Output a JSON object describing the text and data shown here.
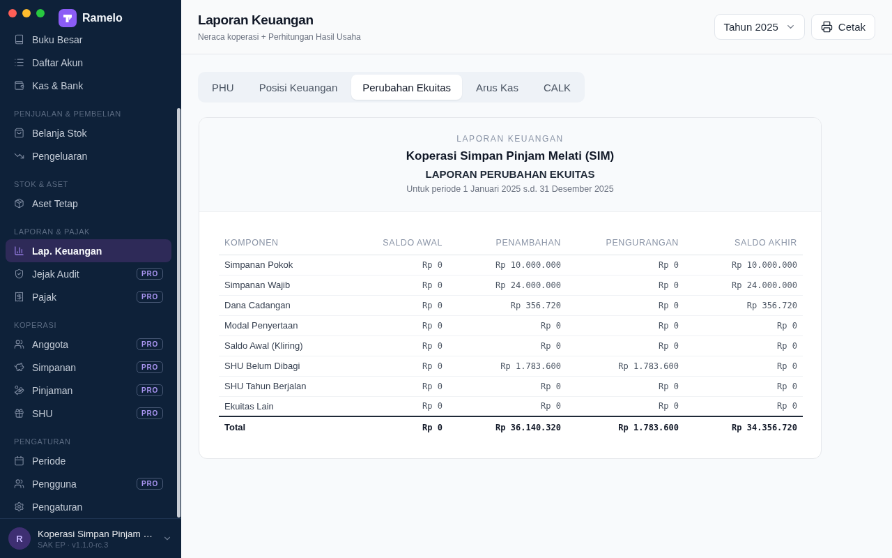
{
  "sidebar": {
    "app_name": "Ramelo",
    "sections": [
      {
        "items": [
          {
            "label": "Buku Besar",
            "selected": false
          },
          {
            "label": "Daftar Akun",
            "selected": false
          },
          {
            "label": "Kas & Bank",
            "selected": false
          }
        ]
      },
      {
        "heading": "PENJUALAN & PEMBELIAN",
        "items": [
          {
            "label": "Belanja Stok",
            "selected": false
          },
          {
            "label": "Pengeluaran",
            "selected": false
          }
        ]
      },
      {
        "heading": "STOK & ASET",
        "items": [
          {
            "label": "Aset Tetap",
            "selected": false
          }
        ]
      },
      {
        "heading": "LAPORAN & PAJAK",
        "items": [
          {
            "label": "Lap. Keuangan",
            "selected": true
          },
          {
            "label": "Jejak Audit",
            "selected": false,
            "badge": "PRO"
          },
          {
            "label": "Pajak",
            "selected": false,
            "badge": "PRO"
          }
        ]
      },
      {
        "heading": "KOPERASI",
        "items": [
          {
            "label": "Anggota",
            "selected": false,
            "badge": "PRO"
          },
          {
            "label": "Simpanan",
            "selected": false,
            "badge": "PRO"
          },
          {
            "label": "Pinjaman",
            "selected": false,
            "badge": "PRO"
          },
          {
            "label": "SHU",
            "selected": false,
            "badge": "PRO"
          }
        ]
      },
      {
        "heading": "PENGATURAN",
        "items": [
          {
            "label": "Periode",
            "selected": false
          },
          {
            "label": "Pengguna",
            "selected": false,
            "badge": "PRO"
          },
          {
            "label": "Pengaturan",
            "selected": false
          }
        ]
      }
    ],
    "account": {
      "initial": "R",
      "name": "Koperasi Simpan Pinjam …",
      "subtitle": "SAK EP · v1.1.0-rc.3"
    }
  },
  "header": {
    "title": "Laporan Keuangan",
    "subtitle": "Neraca koperasi + Perhitungan Hasil Usaha",
    "year_select": {
      "value": "Tahun 2025"
    },
    "print_button": {
      "label": "Cetak"
    }
  },
  "tabs": [
    {
      "label": "PHU",
      "selected": false
    },
    {
      "label": "Posisi Keuangan",
      "selected": false
    },
    {
      "label": "Perubahan Ekuitas",
      "selected": true
    },
    {
      "label": "Arus Kas",
      "selected": false
    },
    {
      "label": "CALK",
      "selected": false
    }
  ],
  "report": {
    "eyebrow": "LAPORAN KEUANGAN",
    "organization": "Koperasi Simpan Pinjam Melati (SIM)",
    "title": "LAPORAN PERUBAHAN EKUITAS",
    "period": "Untuk periode 1 Januari 2025 s.d. 31 Desember 2025",
    "table": {
      "columns": [
        "KOMPONEN",
        "SALDO AWAL",
        "PENAMBAHAN",
        "PENGURANGAN",
        "SALDO AKHIR"
      ],
      "rows": [
        [
          "Simpanan Pokok",
          "Rp 0",
          "Rp 10.000.000",
          "Rp 0",
          "Rp 10.000.000"
        ],
        [
          "Simpanan Wajib",
          "Rp 0",
          "Rp 24.000.000",
          "Rp 0",
          "Rp 24.000.000"
        ],
        [
          "Dana Cadangan",
          "Rp 0",
          "Rp 356.720",
          "Rp 0",
          "Rp 356.720"
        ],
        [
          "Modal Penyertaan",
          "Rp 0",
          "Rp 0",
          "Rp 0",
          "Rp 0"
        ],
        [
          "Saldo Awal (Kliring)",
          "Rp 0",
          "Rp 0",
          "Rp 0",
          "Rp 0"
        ],
        [
          "SHU Belum Dibagi",
          "Rp 0",
          "Rp 1.783.600",
          "Rp 1.783.600",
          "Rp 0"
        ],
        [
          "SHU Tahun Berjalan",
          "Rp 0",
          "Rp 0",
          "Rp 0",
          "Rp 0"
        ],
        [
          "Ekuitas Lain",
          "Rp 0",
          "Rp 0",
          "Rp 0",
          "Rp 0"
        ]
      ],
      "total": [
        "Total",
        "Rp 0",
        "Rp 36.140.320",
        "Rp 1.783.600",
        "Rp 34.356.720"
      ]
    }
  }
}
